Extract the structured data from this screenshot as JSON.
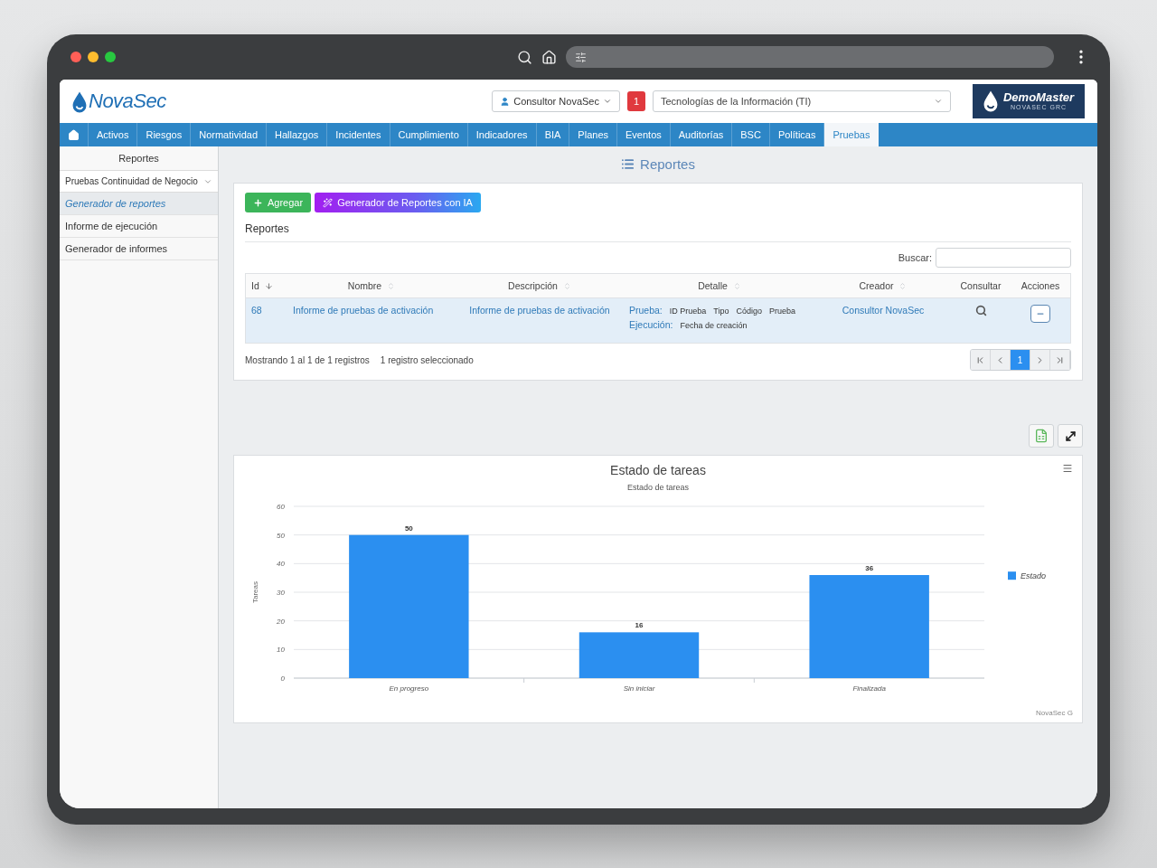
{
  "header": {
    "brand": "NovaSec",
    "user_menu": "Consultor NovaSec",
    "notification_count": "1",
    "area_select": "Tecnologías de la Información (TI)",
    "client_logo": {
      "name": "DemoMaster",
      "tagline": "NOVASEC GRC"
    }
  },
  "nav": {
    "items": [
      {
        "label": "Activos",
        "selected": false
      },
      {
        "label": "Riesgos",
        "selected": false
      },
      {
        "label": "Normatividad",
        "selected": false
      },
      {
        "label": "Hallazgos",
        "selected": false
      },
      {
        "label": "Incidentes",
        "selected": false
      },
      {
        "label": "Cumplimiento",
        "selected": false
      },
      {
        "label": "Indicadores",
        "selected": false
      },
      {
        "label": "BIA",
        "selected": false
      },
      {
        "label": "Planes",
        "selected": false
      },
      {
        "label": "Eventos",
        "selected": false
      },
      {
        "label": "Auditorías",
        "selected": false
      },
      {
        "label": "BSC",
        "selected": false
      },
      {
        "label": "Políticas",
        "selected": false
      },
      {
        "label": "Pruebas",
        "selected": true
      }
    ]
  },
  "sidebar": {
    "title": "Reportes",
    "category_select": "Pruebas Continuidad de Negocio",
    "items": [
      {
        "label": "Generador de reportes",
        "selected": true
      },
      {
        "label": "Informe de ejecución",
        "selected": false
      },
      {
        "label": "Generador de informes",
        "selected": false
      }
    ]
  },
  "page_title": "Reportes",
  "reports_panel": {
    "buttons": [
      {
        "kind": "add",
        "label": "Agregar"
      },
      {
        "kind": "ai",
        "label": "Generador de Reportes con IA"
      }
    ],
    "title": "Reportes",
    "search_label": "Buscar:",
    "table": {
      "columns": [
        {
          "label": "Id",
          "sortable": true,
          "sorted": true
        },
        {
          "label": "Nombre",
          "sortable": true,
          "sorted": false
        },
        {
          "label": "Descripción",
          "sortable": true,
          "sorted": false
        },
        {
          "label": "Detalle",
          "sortable": true,
          "sorted": false
        },
        {
          "label": "Creador",
          "sortable": true,
          "sorted": false
        },
        {
          "label": "Consultar",
          "sortable": false,
          "sorted": false
        },
        {
          "label": "Acciones",
          "sortable": false,
          "sorted": false
        }
      ],
      "rows": [
        {
          "selected": true,
          "id": "68",
          "name": "Informe de pruebas de activación",
          "description": "Informe de pruebas de activación",
          "detail": [
            {
              "label": "Prueba:",
              "fields": [
                "ID Prueba",
                "Tipo",
                "Código",
                "Prueba"
              ]
            },
            {
              "label": "Ejecución:",
              "fields": [
                "Fecha de creación"
              ]
            }
          ],
          "creator": "Consultor NovaSec"
        }
      ]
    },
    "summary": "Mostrando 1 al 1 de 1 registros",
    "selection": "1 registro seleccionado",
    "pagination": {
      "pages": [
        {
          "label": "1",
          "selected": true
        }
      ]
    }
  },
  "chart_panel": {
    "subtitle": "Estado de tareas",
    "credit": "NovaSec G",
    "chart_data": {
      "type": "bar",
      "title": "Estado de tareas",
      "ylabel": "Tareas",
      "categories": [
        "En progreso",
        "Sin iniciar",
        "Finalizada"
      ],
      "series": [
        {
          "name": "Estado",
          "color": "#2b8ff0",
          "values": [
            50,
            16,
            36
          ]
        }
      ],
      "ylim": [
        0,
        60
      ],
      "yticks": [
        0,
        10,
        20,
        30,
        40,
        50,
        60
      ],
      "grid": true,
      "data_labels": true
    }
  }
}
